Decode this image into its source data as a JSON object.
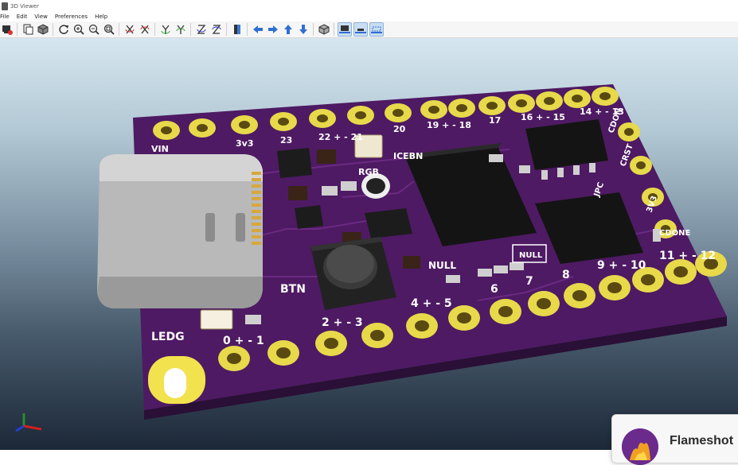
{
  "window": {
    "title": "3D Viewer"
  },
  "menu": [
    "File",
    "Edit",
    "View",
    "Preferences",
    "Help"
  ],
  "toolbar": {
    "groups": [
      [
        "render-icon",
        "copy-image-icon",
        "view-3d-icon"
      ],
      [
        "refresh-icon",
        "zoom-in-icon",
        "zoom-out-icon",
        "zoom-fit-icon"
      ],
      [
        "rotate-x-cw-icon",
        "rotate-x-ccw-icon",
        "rotate-y-cw-icon",
        "rotate-y-ccw-icon",
        "rotate-z-cw-icon",
        "rotate-z-ccw-icon"
      ],
      [
        "flip-board-icon"
      ],
      [
        "pan-left-icon",
        "pan-right-icon",
        "pan-up-icon",
        "pan-down-icon"
      ],
      [
        "toggle-orthographic-icon"
      ],
      [
        "models-tht-icon",
        "models-smd-icon",
        "models-virtual-icon"
      ]
    ]
  },
  "board": {
    "top_pin_labels": [
      "VIN",
      "3v3",
      "23",
      "22 + - 21",
      "20",
      "19 + - 18",
      "17",
      "16 + - 15",
      "14 + - 13"
    ],
    "right_labels": [
      "CDON",
      "CRST",
      "3V3",
      "CDONE"
    ],
    "bottom_pin_labels": [
      "LEDG",
      "0 + - 1",
      "BTN",
      "2 + - 3",
      "4 + - 5",
      "6",
      "7",
      "8",
      "9 + - 10",
      "11 + - 12"
    ],
    "silk_labels": [
      "RGB",
      "ICEBN",
      "NULL",
      "NULL",
      "JPC"
    ],
    "colors": {
      "pcb": "#4e1a63",
      "pad": "#e7d94a",
      "silk": "#ffffff"
    }
  },
  "notification": {
    "app_name": "Flameshot"
  }
}
